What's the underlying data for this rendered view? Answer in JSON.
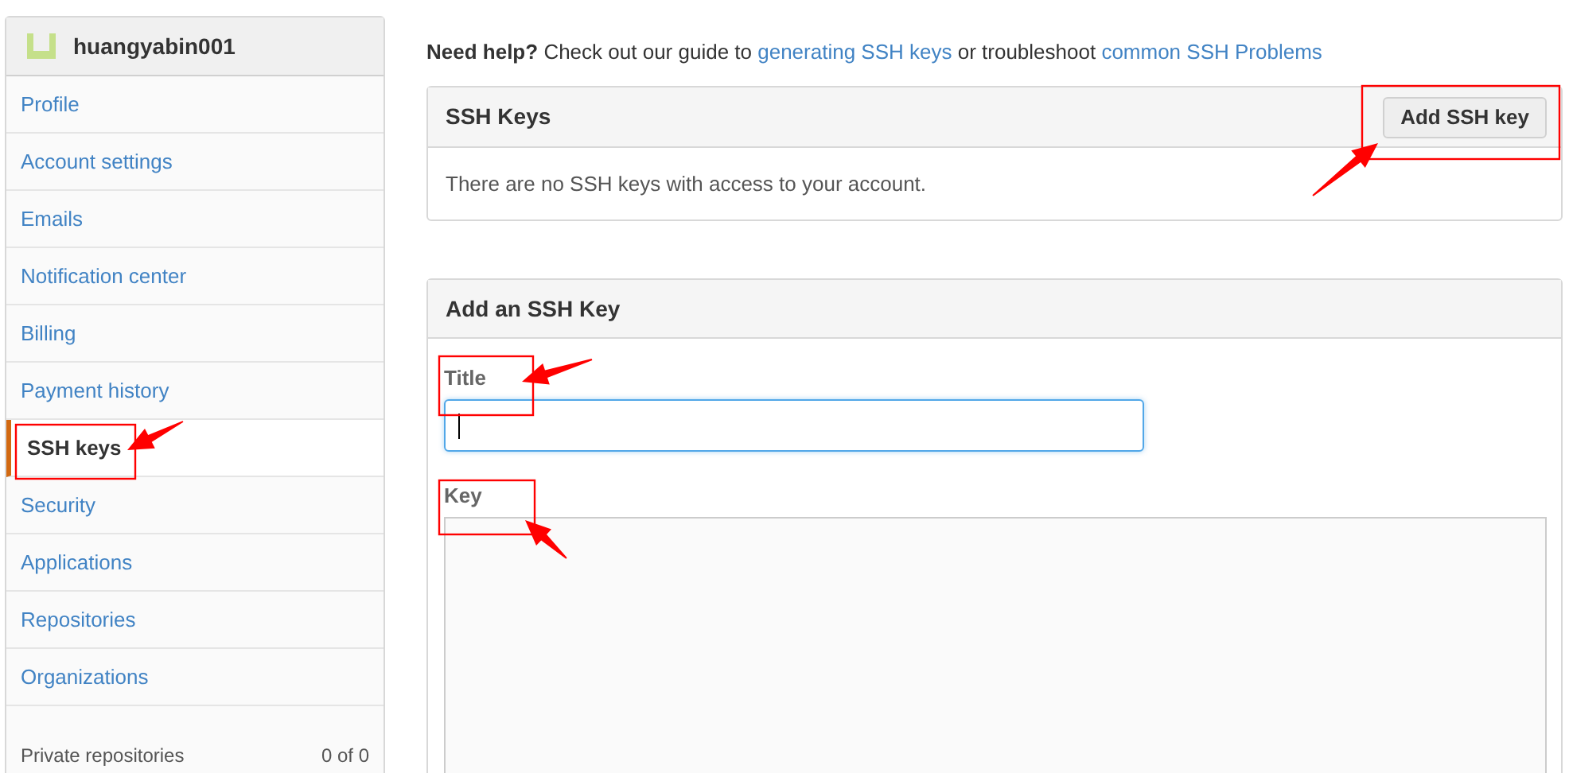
{
  "sidebar": {
    "username": "huangyabin001",
    "items": [
      {
        "label": "Profile",
        "selected": false
      },
      {
        "label": "Account settings",
        "selected": false
      },
      {
        "label": "Emails",
        "selected": false
      },
      {
        "label": "Notification center",
        "selected": false
      },
      {
        "label": "Billing",
        "selected": false
      },
      {
        "label": "Payment history",
        "selected": false
      },
      {
        "label": "SSH keys",
        "selected": true
      },
      {
        "label": "Security",
        "selected": false
      },
      {
        "label": "Applications",
        "selected": false
      },
      {
        "label": "Repositories",
        "selected": false
      },
      {
        "label": "Organizations",
        "selected": false
      }
    ],
    "footer": {
      "label": "Private repositories",
      "value": "0 of 0"
    }
  },
  "help": {
    "lead": "**Need help?** Check out our guide to",
    "link_1": "generating SSH keys",
    "middle": "or troubleshoot",
    "link_2": "common SSH Problems"
  },
  "ssh_keys_panel": {
    "title": "SSH Keys",
    "button": "Add SSH key",
    "message": "There are no SSH keys with access to your account."
  },
  "add_key_panel": {
    "title": "Add an SSH Key",
    "fields": [
      {
        "label": "Title",
        "kind": "input",
        "focused": true
      },
      {
        "label": "Key",
        "kind": "textarea",
        "focused": false
      }
    ]
  }
}
